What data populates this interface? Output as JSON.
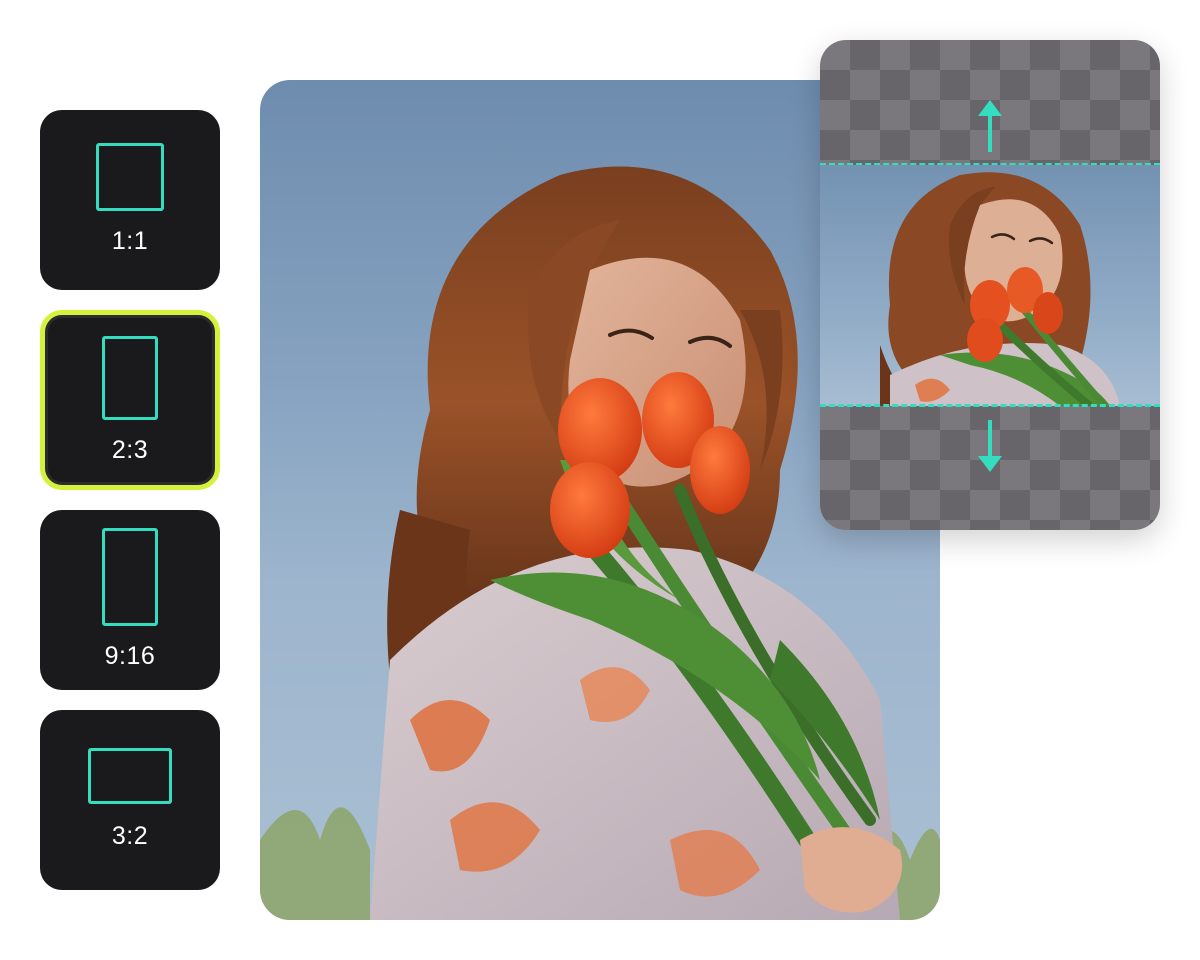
{
  "ratios": [
    {
      "label": "1:1",
      "selected": false
    },
    {
      "label": "2:3",
      "selected": true
    },
    {
      "label": "9:16",
      "selected": false
    },
    {
      "label": "3:2",
      "selected": false
    }
  ],
  "colors": {
    "button_bg": "#1a191c",
    "selected_border": "#d4f23a",
    "accent_teal": "#34dcc0",
    "label_text": "#ffffff"
  },
  "icons": {
    "expand_up": "arrow-up-icon",
    "expand_down": "arrow-down-icon"
  }
}
